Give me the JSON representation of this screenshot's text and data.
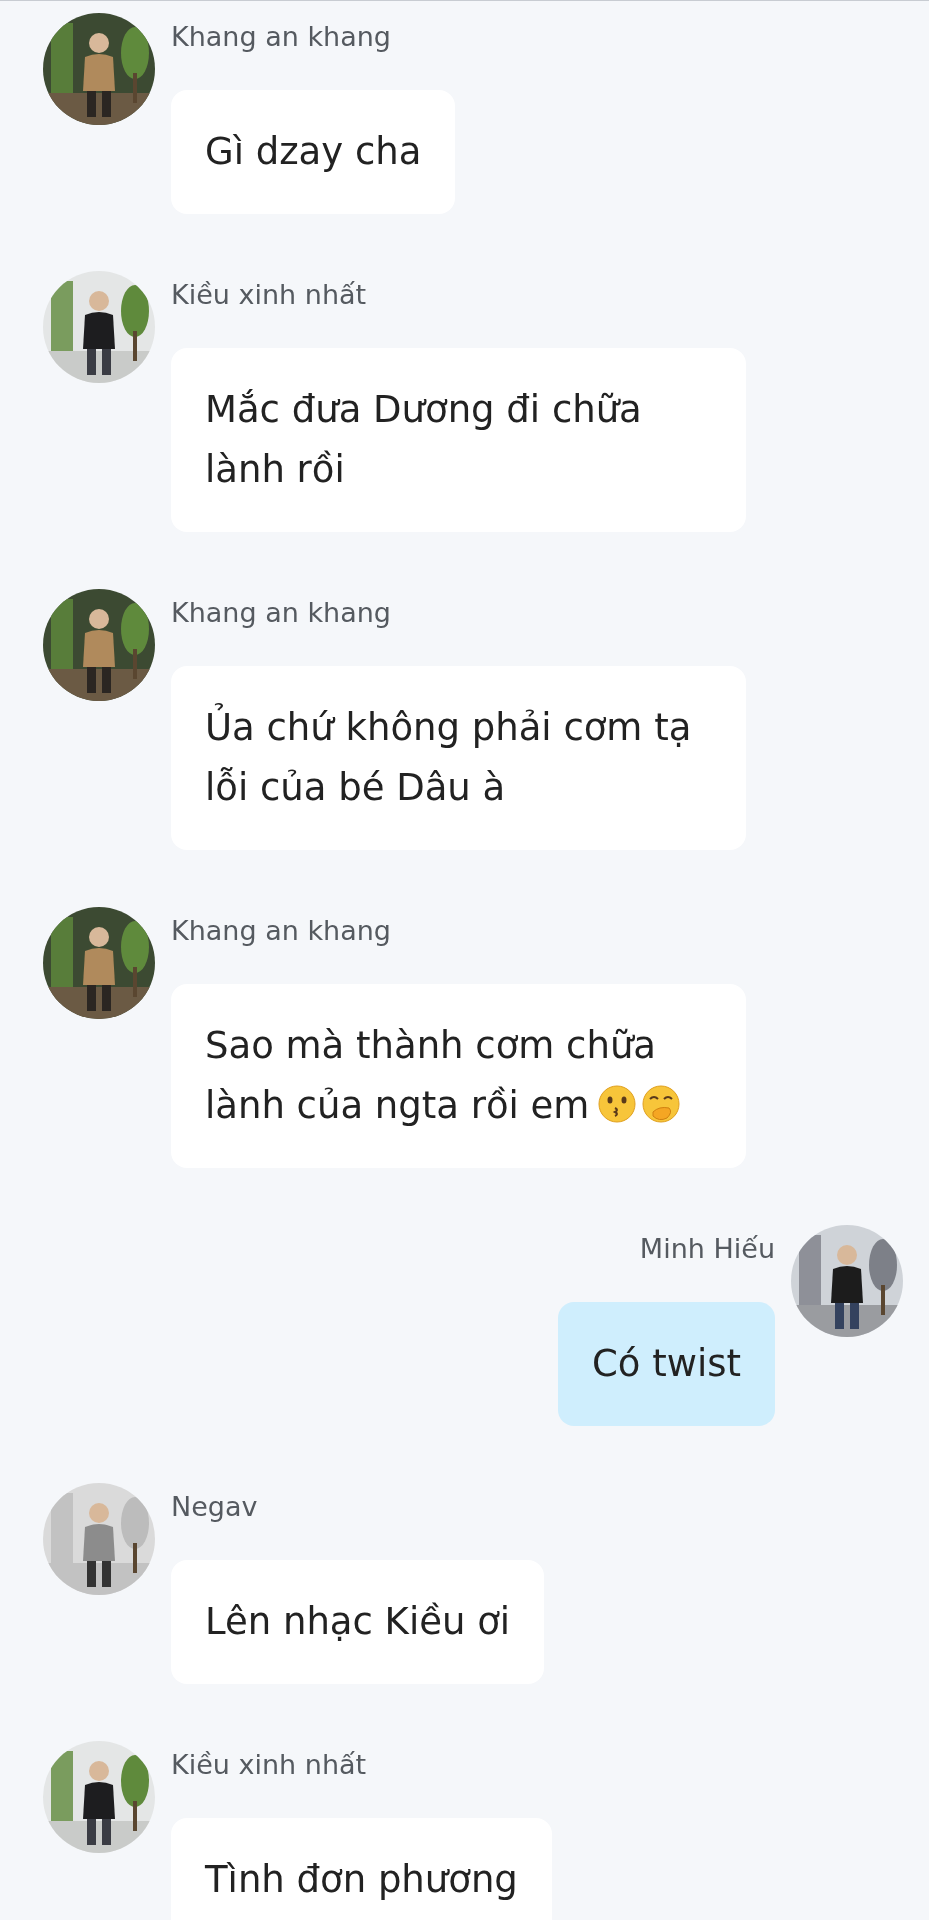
{
  "messages": [
    {
      "sender": "Khang an khang",
      "kind": "incoming",
      "text": "Gì dzay cha"
    },
    {
      "sender": "Kiều xinh nhất",
      "kind": "incoming",
      "text": "Mắc đưa Dương đi chữa lành rồi"
    },
    {
      "sender": "Khang an khang",
      "kind": "incoming",
      "text": "Ủa chứ không phải cơm tạ lỗi của bé Dâu à"
    },
    {
      "sender": "Khang an khang",
      "kind": "incoming",
      "text": "Sao mà thành cơm chữa lành của ngta rồi em",
      "emojis": [
        {
          "kind": "kissing"
        },
        {
          "kind": "hand-over-mouth"
        }
      ]
    },
    {
      "sender": "Minh Hiếu",
      "kind": "outgoing",
      "text": "Có twist"
    },
    {
      "sender": "Negav",
      "kind": "incoming",
      "text": "Lên nhạc Kiều ơi"
    },
    {
      "sender": "Kiều xinh nhất",
      "kind": "incoming",
      "text": "Tình đơn phương"
    }
  ]
}
